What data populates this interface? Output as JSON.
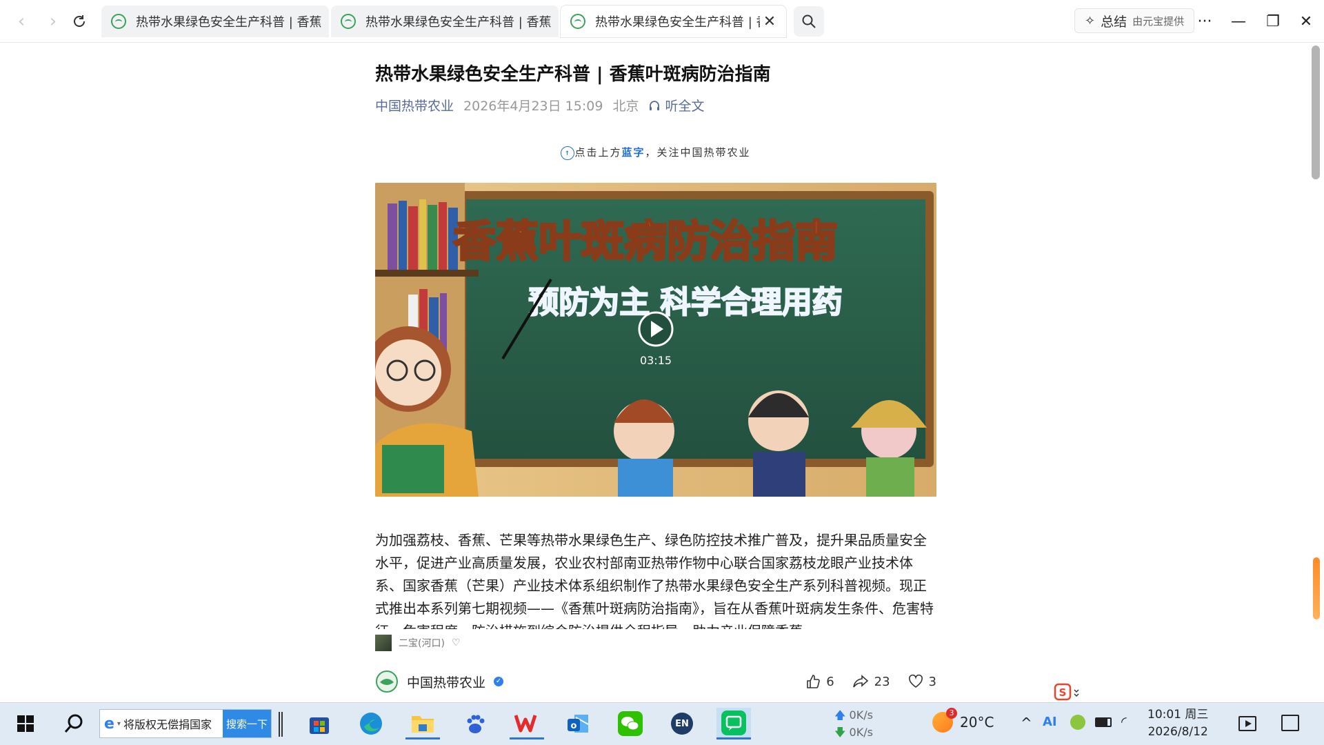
{
  "browser": {
    "tabs": [
      {
        "title": "热带水果绿色安全生产科普 | 香蕉叶斑病防治指南"
      },
      {
        "title": "热带水果绿色安全生产科普 | 香蕉枯萎病防治指南"
      },
      {
        "title": "热带水果绿色安全生产科普 | 香蕉叶斑病防治指南"
      }
    ],
    "summary_label": "总结",
    "summary_provider": "由元宝提供"
  },
  "article": {
    "title": "热带水果绿色安全生产科普 | 香蕉叶斑病防治指南",
    "author": "中国热带农业",
    "date": "2026年4月23日 15:09",
    "location": "北京",
    "listen_label": "听全文",
    "follow_prefix": "点击上方",
    "follow_highlight": "蓝字",
    "follow_suffix": "，关注中国热带农业",
    "video": {
      "headline": "香蕉叶斑病防治指南",
      "subline": "预防为主 科学合理用药",
      "duration": "03:15"
    },
    "paragraph": "为加强荔枝、香蕉、芒果等热带水果绿色生产、绿色防控技术推广普及，提升果品质量安全水平，促进产业高质量发展，农业农村部南亚热带作物中心联合国家荔枝龙眼产业技术体系、国家香蕉（芒果）产业技术体系组织制作了热带水果绿色安全生产系列科普视频。现正式推出本系列第七期视频——《香蕉叶斑病防治指南》，旨在从香蕉叶斑病发生条件、危害特征、危害程度、防治措施到综合防治提供全程指导，助力产业保障香蕉",
    "danmu_user": "二宝(河口)",
    "account": "中国热带农业",
    "likes": "6",
    "shares": "23",
    "favorites": "3"
  },
  "taskbar": {
    "search_text": "将版权无偿捐国家",
    "search_button": "搜索一下",
    "net_up": "0K/s",
    "net_down": "0K/s",
    "weather_badge": "3",
    "temperature": "20°C",
    "ime": "EN",
    "time": "10:01 周三",
    "date": "2026/8/12"
  }
}
